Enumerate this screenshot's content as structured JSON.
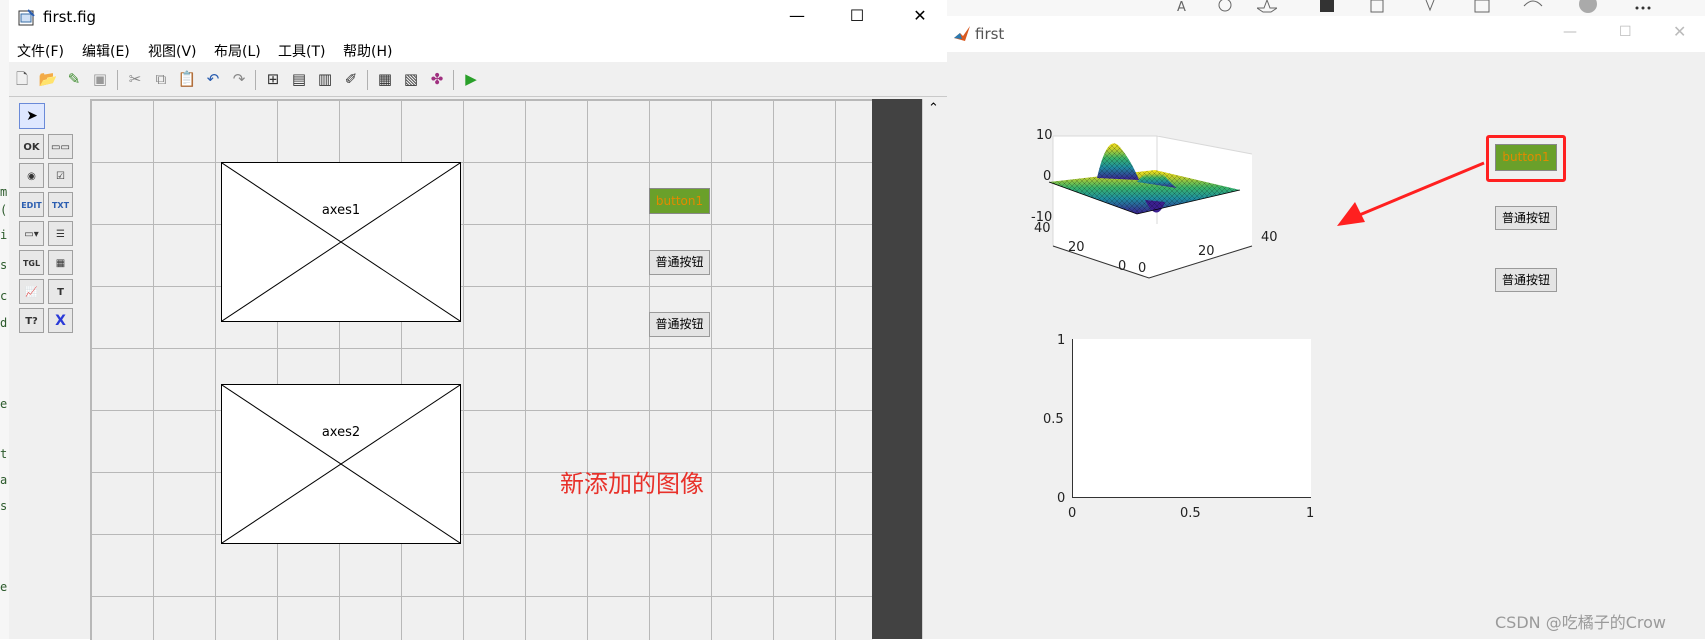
{
  "editor_fragments": [
    "m",
    "(",
    "i",
    "s",
    "c",
    "d",
    "e",
    "t",
    "a",
    "s",
    "e"
  ],
  "guide": {
    "title": "first.fig",
    "controls": {
      "minimize": "—",
      "maximize": "☐",
      "close": "✕"
    },
    "menu": [
      "文件(F)",
      "编辑(E)",
      "视图(V)",
      "布局(L)",
      "工具(T)",
      "帮助(H)"
    ],
    "palette": [
      "OK",
      "▭▭",
      "◉",
      "☑",
      "EDIT",
      "TXT",
      "▭▾",
      "☰",
      "TGL",
      "▦",
      "📈",
      "T",
      "T?",
      "X"
    ],
    "axes1_label": "axes1",
    "axes2_label": "axes2",
    "button1_label": "button1",
    "button2_label": "普通按钮",
    "button3_label": "普通按钮",
    "annotation": "新添加的图像"
  },
  "figure": {
    "title": "first",
    "button1_label": "button1",
    "button2_label": "普通按钮",
    "button3_label": "普通按钮",
    "axes1": {
      "z_ticks": [
        "10",
        "0",
        "-10"
      ],
      "y_ticks": [
        "40",
        "20",
        "0"
      ],
      "x_ticks": [
        "0",
        "20",
        "40"
      ]
    },
    "axes2": {
      "y_ticks": [
        "1",
        "0.5",
        "0"
      ],
      "x_ticks": [
        "0",
        "0.5",
        "1"
      ]
    }
  },
  "watermark": "CSDN @吃橘子的Crow",
  "colors": {
    "annotation": "#e8312a",
    "button_green": "#6aa02a",
    "button_text": "#e28a00",
    "highlight": "#ff2020"
  }
}
